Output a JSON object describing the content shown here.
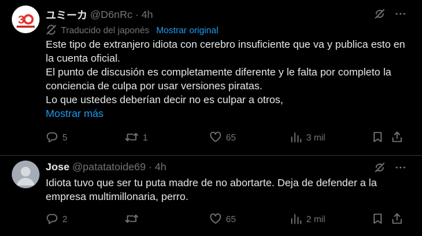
{
  "posts": [
    {
      "name": "ユミーカ",
      "handle": "@D6nRc",
      "dot": "·",
      "time": "4h",
      "translated_label": "Traducido del japonés",
      "show_original": "Mostrar original",
      "text_lines": [
        "Este tipo de extranjero idiota con cerebro insuficiente que va y publica esto en la cuenta oficial.",
        "El punto de discusión es completamente diferente y le falta por completo la conciencia de culpa por usar versiones piratas.",
        "Lo que ustedes deberían decir no es culpar a otros,"
      ],
      "show_more": "Mostrar más",
      "replies": "5",
      "reposts": "1",
      "likes": "65",
      "views": "3 mil"
    },
    {
      "name": "Jose",
      "handle": "@patatatoide69",
      "dot": "·",
      "time": "4h",
      "text_lines": [
        "Idiota tuvo que ser tu puta madre de no abortarte. Deja de defender a la empresa multimillonaria, perro."
      ],
      "replies": "2",
      "reposts": "",
      "likes": "65",
      "views": "2 mil"
    }
  ],
  "colors": {
    "background": "#000000",
    "text": "#e7e9ea",
    "muted": "#71767b",
    "link": "#1d9bf0",
    "divider": "#2f3336"
  },
  "icons": [
    "grok-icon",
    "more-icon",
    "translate-icon",
    "reply-icon",
    "repost-icon",
    "like-icon",
    "views-icon",
    "bookmark-icon",
    "share-icon"
  ]
}
